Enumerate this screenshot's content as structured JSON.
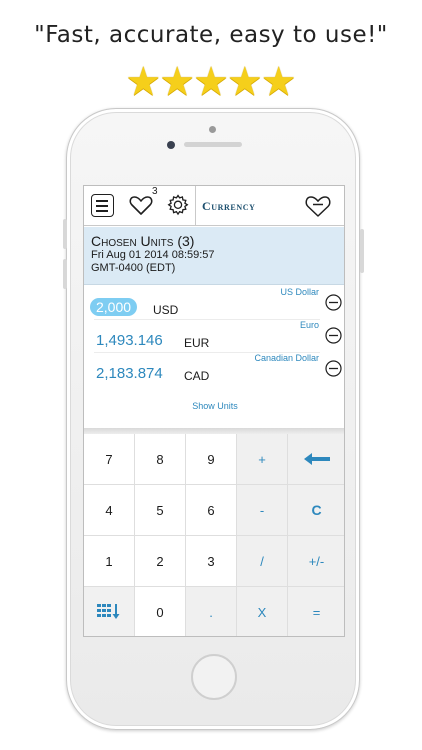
{
  "headline": "\"Fast, accurate, easy to use!\"",
  "rating": {
    "stars": 5,
    "max": 5,
    "star_glyph": "★",
    "star_color": "#f5cf1b"
  },
  "toolbar": {
    "menu_icon": "menu-icon",
    "favorites_count": "3",
    "title": "Currency"
  },
  "info": {
    "title": "Chosen Units (3)",
    "datetime": "Fri Aug 01 2014 08:59:57",
    "timezone": "GMT-0400 (EDT)"
  },
  "units": [
    {
      "name": "US Dollar",
      "amount": "2,000",
      "code": "USD",
      "selected": true
    },
    {
      "name": "Euro",
      "amount": "1,493.146",
      "code": "EUR",
      "selected": false
    },
    {
      "name": "Canadian Dollar",
      "amount": "2,183.874",
      "code": "CAD",
      "selected": false
    }
  ],
  "show_units_label": "Show Units",
  "keypad": {
    "row1": [
      "7",
      "8",
      "9",
      "+",
      "←"
    ],
    "row2": [
      "4",
      "5",
      "6",
      "-",
      "C"
    ],
    "row3": [
      "1",
      "2",
      "3",
      "/",
      "+/-"
    ],
    "row4": [
      "",
      "0",
      ".",
      "X",
      "="
    ]
  },
  "colors": {
    "accent": "#2d88bd",
    "panel": "#dbeaf5",
    "selected_pill": "#7ecdf2"
  }
}
